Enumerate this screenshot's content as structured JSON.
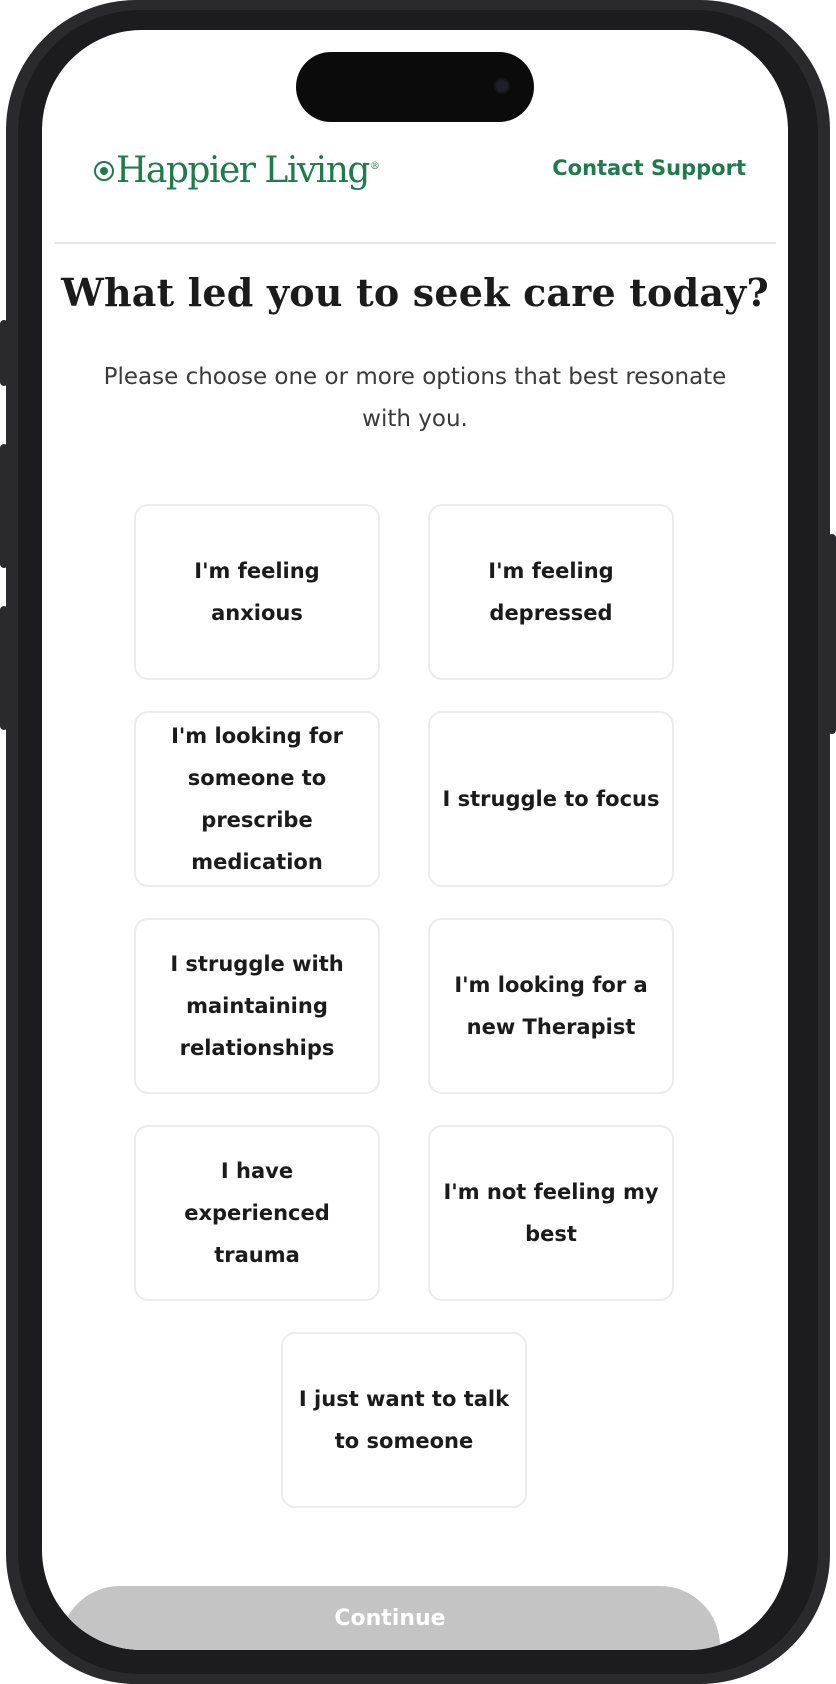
{
  "header": {
    "logo_icon": "leaf-logo-icon",
    "brand_name": "Happier Living",
    "contact_label": "Contact Support"
  },
  "question": {
    "title": "What led you to seek care today?",
    "subtitle": "Please choose one or more options that best resonate with you."
  },
  "options": [
    {
      "label": "I'm feeling anxious"
    },
    {
      "label": "I'm feeling depressed"
    },
    {
      "label": "I'm looking for someone to prescribe medication"
    },
    {
      "label": "I struggle to focus"
    },
    {
      "label": "I struggle with maintaining relationships"
    },
    {
      "label": "I'm looking for a new Therapist"
    },
    {
      "label": "I have experienced trauma"
    },
    {
      "label": "I'm not feeling my best"
    },
    {
      "label": "I just want to talk to someone"
    }
  ],
  "footer": {
    "continue_label": "Continue"
  },
  "colors": {
    "brand_green": "#1f7a4c",
    "continue_disabled": "#c4c4c4"
  }
}
